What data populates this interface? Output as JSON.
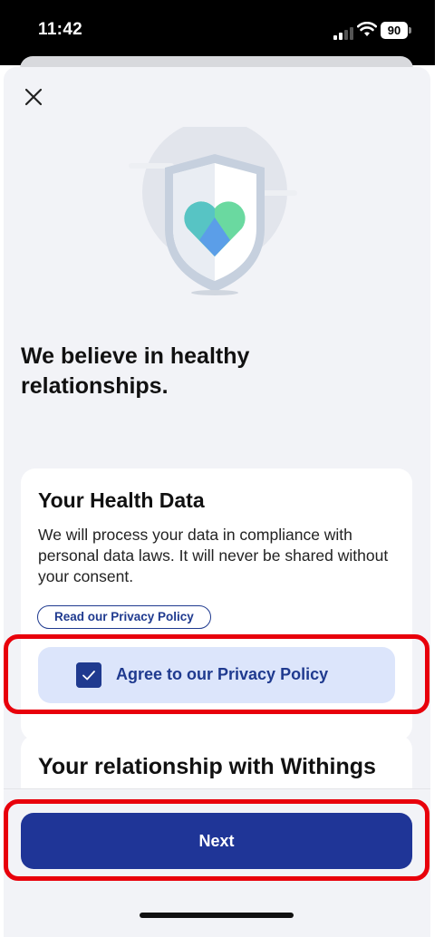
{
  "status_bar": {
    "time": "11:42",
    "battery": "90",
    "icons": [
      "cellular-signal-icon",
      "wifi-icon",
      "battery-icon"
    ]
  },
  "sheet": {
    "close_icon": "close-icon",
    "illustration": "shield-heart-illustration",
    "headline": "We believe in healthy relationships."
  },
  "health_card": {
    "title": "Your Health Data",
    "body": "We will process your data in compliance with personal data laws. It will never be shared without your consent.",
    "privacy_link_label": "Read our Privacy Policy",
    "agree_label": "Agree to our Privacy Policy",
    "agree_checked": true
  },
  "relationship_card": {
    "title": "Your relationship with Withings"
  },
  "footer": {
    "next_label": "Next"
  },
  "colors": {
    "accent": "#1f3597",
    "agree_background": "#dce5fb",
    "highlight": "#e8000b",
    "sheet_background": "#f2f3f7"
  }
}
